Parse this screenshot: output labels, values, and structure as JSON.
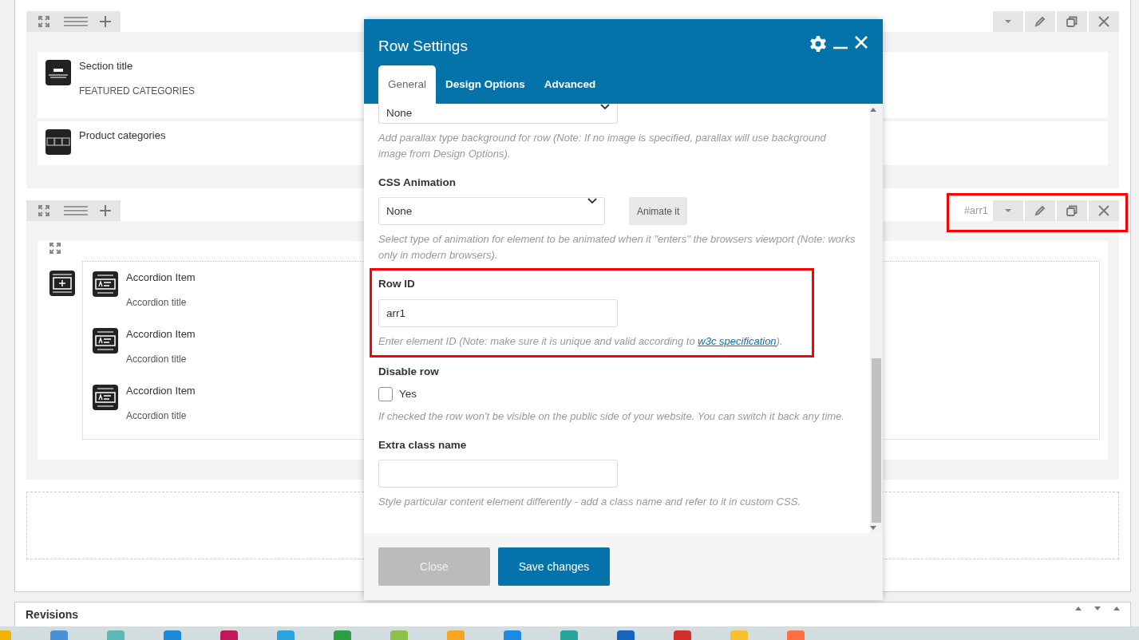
{
  "builder": {
    "rows": [
      {
        "highlighted": false,
        "content": [
          {
            "kind": "title",
            "name": "Section title",
            "value": "FEATURED CATEGORIES"
          },
          {
            "kind": "categories",
            "name": "Product categories"
          }
        ]
      },
      {
        "id_label": "#arr1",
        "highlighted": true,
        "content": [
          {
            "kind": "accordion",
            "items": [
              {
                "name": "Accordion Item",
                "value": "Accordion title"
              },
              {
                "name": "Accordion Item",
                "value": "Accordion title"
              },
              {
                "name": "Accordion Item",
                "value": "Accordion title"
              }
            ]
          }
        ]
      }
    ]
  },
  "revisions": {
    "title": "Revisions"
  },
  "modal": {
    "title": "Row Settings",
    "tabs": [
      {
        "label": "General",
        "selected": true
      },
      {
        "label": "Design Options",
        "selected": false
      },
      {
        "label": "Advanced",
        "selected": false
      }
    ],
    "fields": [
      {
        "kind": "select",
        "value": "None",
        "help": "Add parallax type background for row (Note: If no image is specified, parallax will use background image from Design Options)."
      },
      {
        "kind": "select",
        "label": "CSS Animation",
        "value": "None",
        "button": "Animate it",
        "help": "Select type of animation for element to be animated when it \"enters\" the browsers viewport (Note: works only in modern browsers)."
      },
      {
        "kind": "text",
        "label": "Row ID",
        "value": "arr1",
        "highlighted": true,
        "help": "Enter element ID (Note: make sure it is unique and valid according to ",
        "link": "w3c specification",
        "help_end": ")."
      },
      {
        "kind": "checkbox",
        "label": "Disable row",
        "option": "Yes",
        "checked": false,
        "help": "If checked the row won't be visible on the public side of your website. You can switch it back any time."
      },
      {
        "kind": "text",
        "label": "Extra class name",
        "help": "Style particular content element differently - add a class name and refer to it in custom CSS."
      }
    ],
    "buttons": [
      {
        "kind": "secondary",
        "label": "Close"
      },
      {
        "kind": "primary",
        "label": "Save changes"
      }
    ]
  }
}
